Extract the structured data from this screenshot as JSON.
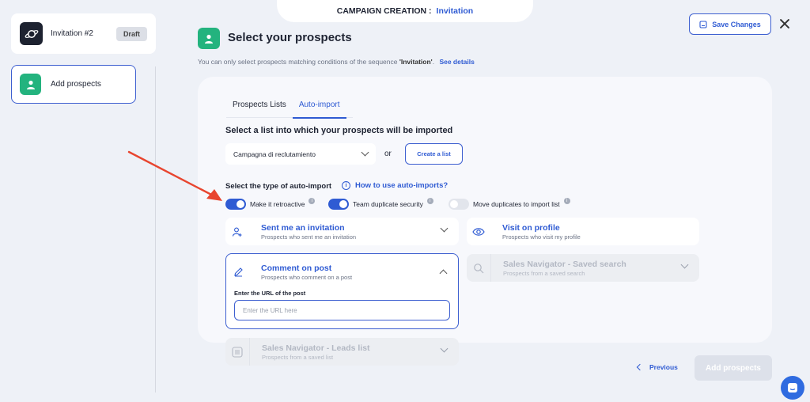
{
  "header": {
    "prefix": "CAMPAIGN CREATION :",
    "campaign": "Invitation"
  },
  "toolbar": {
    "save_label": "Save Changes"
  },
  "sidebar": {
    "campaign_name": "Invitation #2",
    "status_badge": "Draft",
    "step_label": "Add prospects"
  },
  "page": {
    "title": "Select your prospects",
    "subtext_prefix": "You can only select prospects matching conditions of the sequence ",
    "subtext_sequence": "'Invitation'",
    "subtext_suffix": ".",
    "see_details": "See details"
  },
  "tabs": [
    {
      "label": "Prospects Lists",
      "active": false
    },
    {
      "label": "Auto-import",
      "active": true
    }
  ],
  "import_list": {
    "heading": "Select a list into which your prospects will be imported",
    "selected": "Campagna di reclutamiento",
    "or": "or",
    "create_label": "Create a list"
  },
  "auto_import": {
    "heading": "Select the type of auto-import",
    "help_link": "How to use auto-imports?",
    "toggles": [
      {
        "label": "Make it retroactive",
        "on": true
      },
      {
        "label": "Team duplicate security",
        "on": true
      },
      {
        "label": "Move duplicates to import list",
        "on": false
      }
    ],
    "options": [
      {
        "title": "Sent me an invitation",
        "desc": "Prospects who sent me an invitation",
        "icon": "user-plus-icon",
        "enabled": true
      },
      {
        "title": "Visit on profile",
        "desc": "Prospects who visit my profile",
        "icon": "eye-icon",
        "enabled": true
      },
      {
        "title": "Comment on post",
        "desc": "Prospects who comment on a post",
        "icon": "pencil-icon",
        "enabled": true,
        "expanded": true
      },
      {
        "title": "Sales Navigator - Saved search",
        "desc": "Prospects from a saved search",
        "icon": "search-icon",
        "enabled": false
      },
      {
        "title": "Sales Navigator - Leads list",
        "desc": "Prospects from a saved list",
        "icon": "list-icon",
        "enabled": false
      }
    ],
    "url_label": "Enter the URL of the post",
    "url_placeholder": "Enter the URL here"
  },
  "footer": {
    "previous": "Previous",
    "add_label": "Add prospects"
  },
  "colors": {
    "accent": "#2f5bd3",
    "green": "#23b37e",
    "arrow": "#e8452f"
  }
}
